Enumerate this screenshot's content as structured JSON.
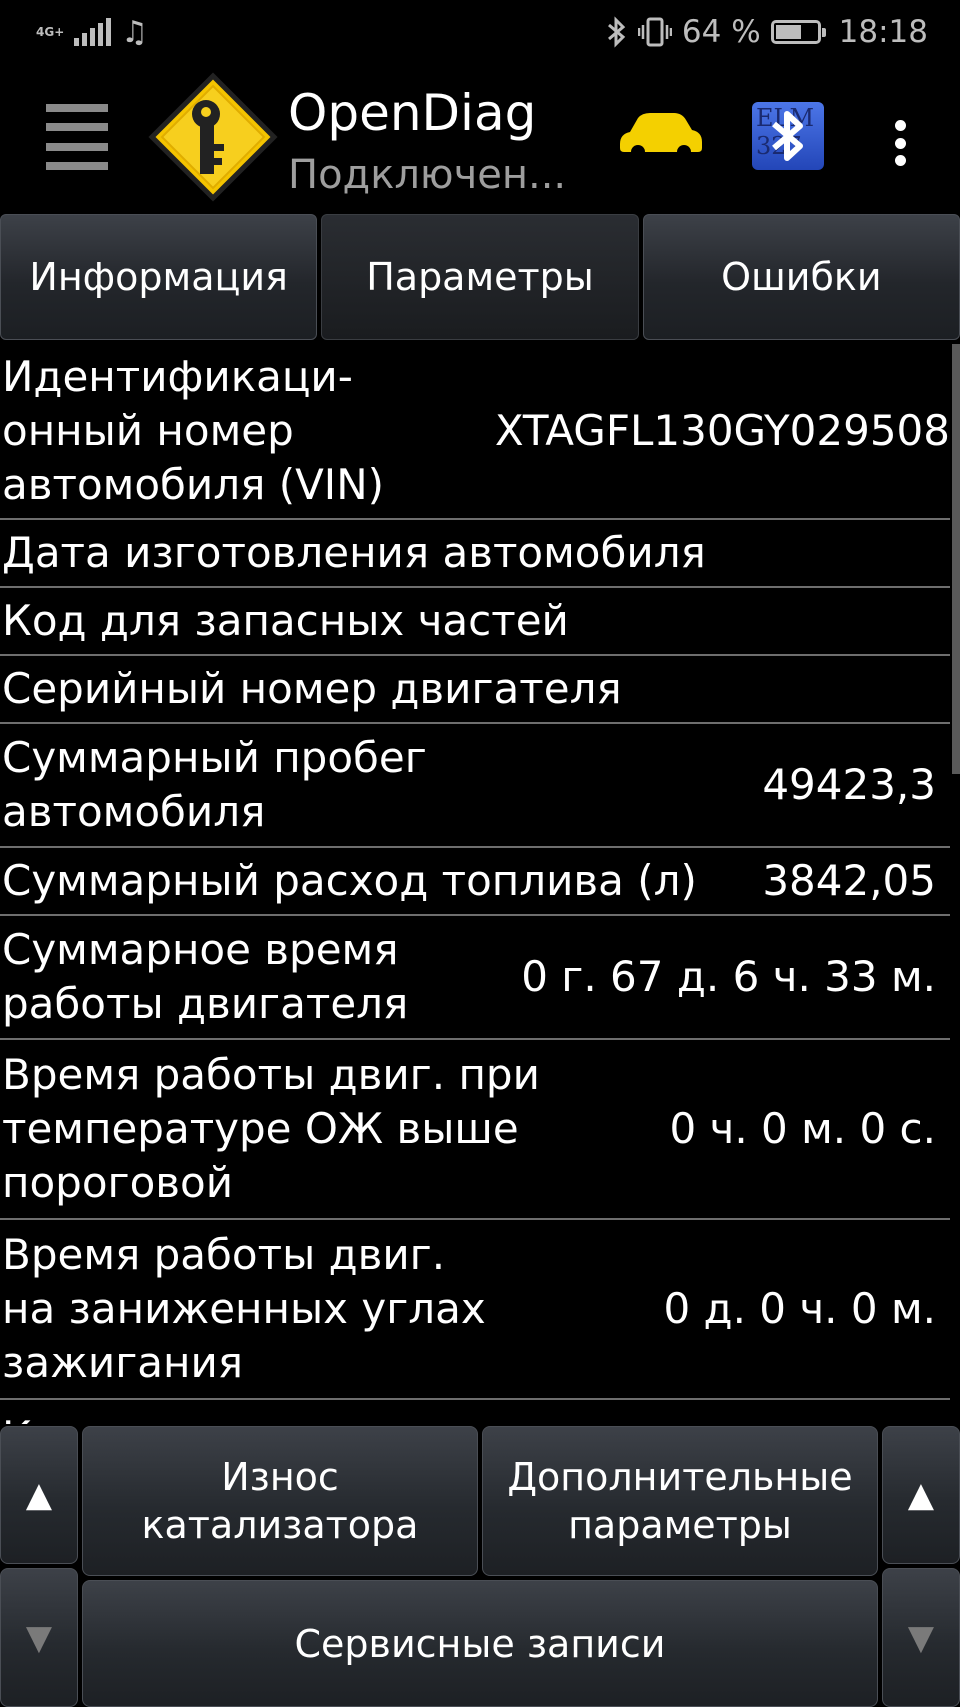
{
  "status": {
    "network": "4G+",
    "battery": "64 %",
    "battery_level": 0.64,
    "time": "18:18"
  },
  "appbar": {
    "title": "OpenDiag",
    "subtitle": "Подключен...",
    "bt_badge": "ELM 327",
    "icons": [
      "menu-icon",
      "app-logo-key",
      "car-icon",
      "bluetooth-elm-icon",
      "overflow-menu-icon"
    ]
  },
  "tabs": [
    {
      "label": "Информация",
      "active": false
    },
    {
      "label": "Параметры",
      "active": true
    },
    {
      "label": "Ошибки",
      "active": false
    }
  ],
  "rows": [
    {
      "label": "Идентификаци-\nонный номер\nавтомобиля (VIN)",
      "value": "XTAGFL130GY029508"
    },
    {
      "label": "Дата изготовления автомобиля",
      "value": ""
    },
    {
      "label": "Код для запасных частей",
      "value": ""
    },
    {
      "label": "Серийный номер двигателя",
      "value": ""
    },
    {
      "label": "Суммарный пробег\nавтомобиля",
      "value": "49423,3"
    },
    {
      "label": "Суммарный расход топлива (л)",
      "value": "3842,05"
    },
    {
      "label": "Суммарное время\nработы двигателя",
      "value": "0 г. 67 д. 6 ч. 33 м."
    },
    {
      "label": "Время работы двиг. при\nтемпературе ОЖ выше\nпороговой",
      "value": "0 ч. 0 м. 0 с."
    },
    {
      "label": "Время работы двиг.\nна заниженных углах\nзажигания",
      "value": "0 д. 0 ч. 0 м."
    },
    {
      "label": "Количество попыток пусков",
      "value": ""
    }
  ],
  "bottom": {
    "up_arrow": "▲",
    "down_arrow": "▼",
    "catalyst_label": "Износ\nкатализатора",
    "extra_params_label": "Дополнительные\nпараметры",
    "service_records_label": "Сервисные записи"
  }
}
